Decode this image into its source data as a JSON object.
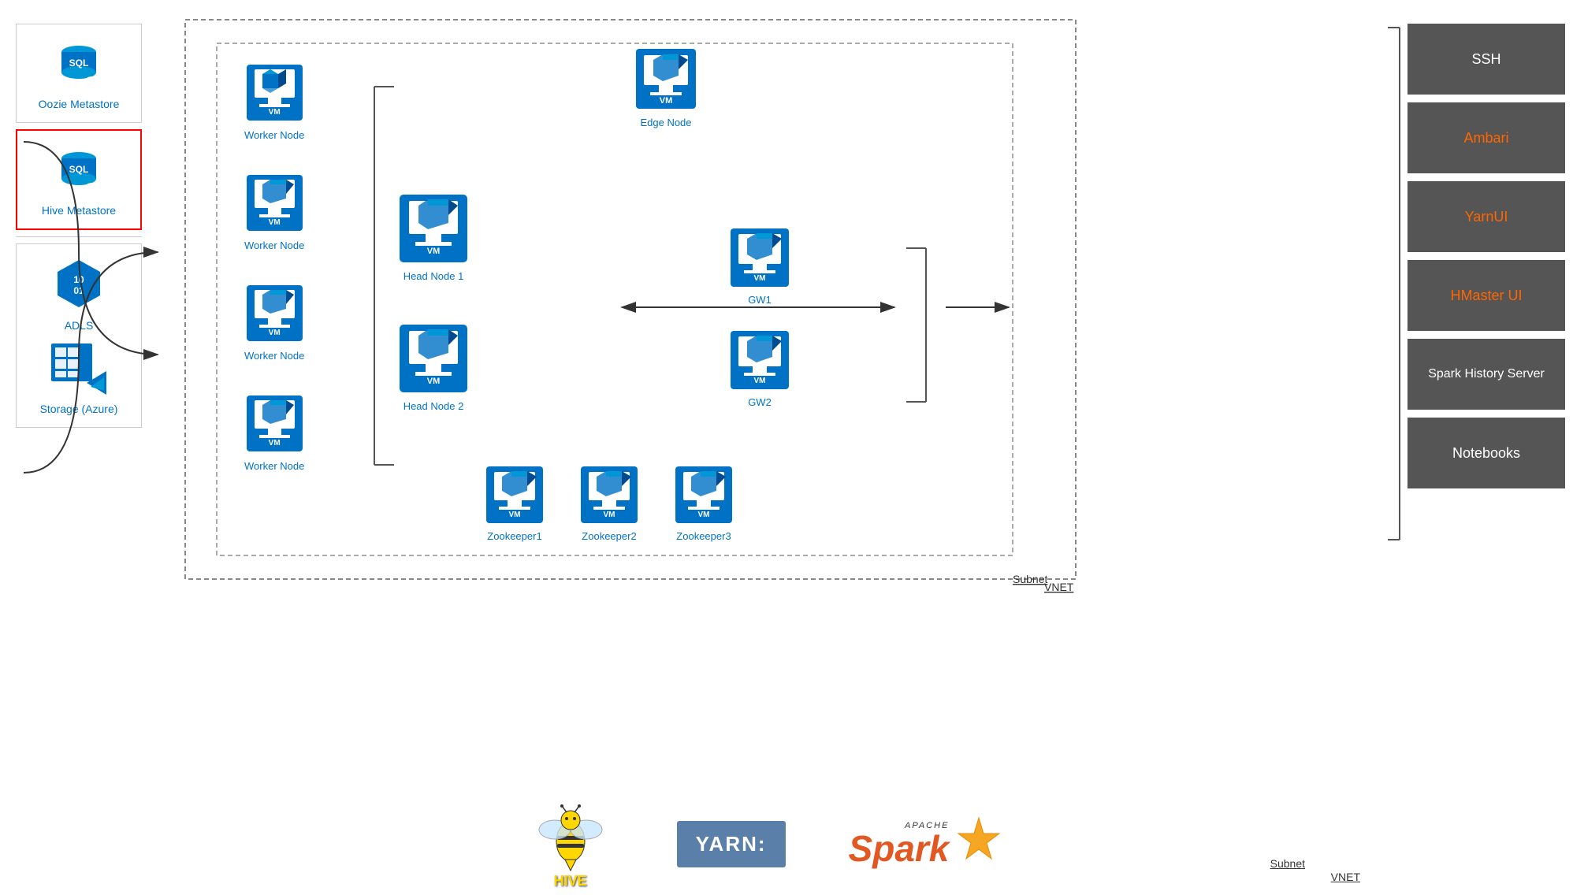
{
  "left": {
    "oozie_label": "Oozie Metastore",
    "hive_label": "Hive Metastore",
    "adls_label": "ADLS",
    "storage_label": "Storage (Azure)"
  },
  "diagram": {
    "vnet_label": "VNET",
    "subnet_label": "Subnet",
    "nodes": {
      "worker1": "Worker Node",
      "worker2": "Worker Node",
      "worker3": "Worker Node",
      "worker4": "Worker Node",
      "head1": "Head Node 1",
      "head2": "Head Node 2",
      "edge": "Edge Node",
      "gw1": "GW1",
      "gw2": "GW2",
      "zk1": "Zookeeper1",
      "zk2": "Zookeeper2",
      "zk3": "Zookeeper3"
    },
    "vm_text": "VM"
  },
  "right_panel": {
    "ssh_label": "SSH",
    "ambari_label": "Ambari",
    "yarn_label": "YarnUI",
    "hmaster_label": "HMaster UI",
    "spark_label": "Spark History Server",
    "notebooks_label": "Notebooks"
  },
  "bottom": {
    "hive_text": "HIVE",
    "yarn_text": "YARN:",
    "spark_text": "Spark"
  }
}
